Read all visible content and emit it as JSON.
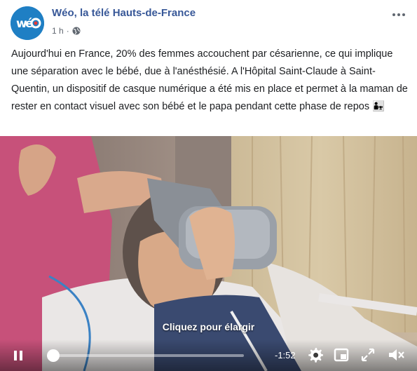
{
  "post": {
    "page_name": "Wéo, la télé Hauts-de-France",
    "avatar_text": "wéo",
    "timestamp": "1 h",
    "separator": "·",
    "text": "Aujourd'hui en France, 20% des femmes accouchent par césarienne, ce qui implique une séparation avec le bébé, due à l'anésthésié. A l'Hôpital Saint-Claude à Saint-Quentin, un dispositif de casque numérique a été mis en place et permet à la maman de rester en contact visuel avec son bébé et le papa pendant cette phase de repos 👨‍👧"
  },
  "video": {
    "caption": "Cliquez pour élargir",
    "remaining_time": "-1:52",
    "progress_fraction": 0.03
  },
  "icons": {
    "more": "more-horizontal-icon",
    "globe": "globe-icon",
    "pause": "pause-icon",
    "settings": "gear-icon",
    "pip": "picture-in-picture-icon",
    "fullscreen": "fullscreen-icon",
    "mute": "volume-muted-icon"
  },
  "colors": {
    "link": "#385898",
    "text": "#1c1e21",
    "meta": "#606770"
  }
}
